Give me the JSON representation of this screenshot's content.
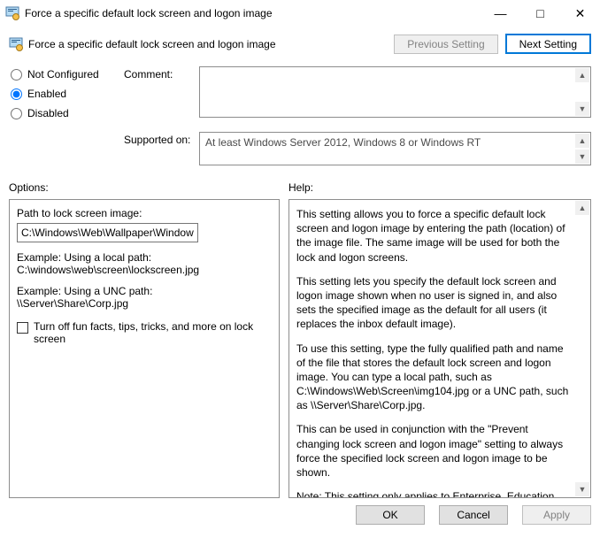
{
  "title": "Force a specific default lock screen and logon image",
  "header_subtitle": "Force a specific default lock screen and logon image",
  "nav": {
    "prev": "Previous Setting",
    "next": "Next Setting"
  },
  "state": {
    "not_configured": "Not Configured",
    "enabled": "Enabled",
    "disabled": "Disabled"
  },
  "labels": {
    "comment": "Comment:",
    "supported": "Supported on:",
    "options": "Options:",
    "help": "Help:"
  },
  "supported_text": "At least Windows Server 2012, Windows 8 or Windows RT",
  "options": {
    "path_label": "Path to lock screen image:",
    "path_value": "C:\\Windows\\Web\\Wallpaper\\Windows\\i",
    "example1a": "Example: Using a local path:",
    "example1b": "C:\\windows\\web\\screen\\lockscreen.jpg",
    "example2a": "Example: Using a UNC path:",
    "example2b": "\\\\Server\\Share\\Corp.jpg",
    "turnoff_label": "Turn off fun facts, tips, tricks, and more on lock screen"
  },
  "help": {
    "p1": "This setting allows you to force a specific default lock screen and logon image by entering the path (location) of the image file. The same image will be used for both the lock and logon screens.",
    "p2": "This setting lets you specify the default lock screen and logon image shown when no user is signed in, and also sets the specified image as the default for all users (it replaces the inbox default image).",
    "p3": "To use this setting, type the fully qualified path and name of the file that stores the default lock screen and logon image. You can type a local path, such as C:\\Windows\\Web\\Screen\\img104.jpg or a UNC path, such as \\\\Server\\Share\\Corp.jpg.",
    "p4": "This can be used in conjunction with the \"Prevent changing lock screen and logon image\" setting to always force the specified lock screen and logon image to be shown.",
    "p5": "Note: This setting only applies to Enterprise, Education, and Server SKUs."
  },
  "footer": {
    "ok": "OK",
    "cancel": "Cancel",
    "apply": "Apply"
  }
}
